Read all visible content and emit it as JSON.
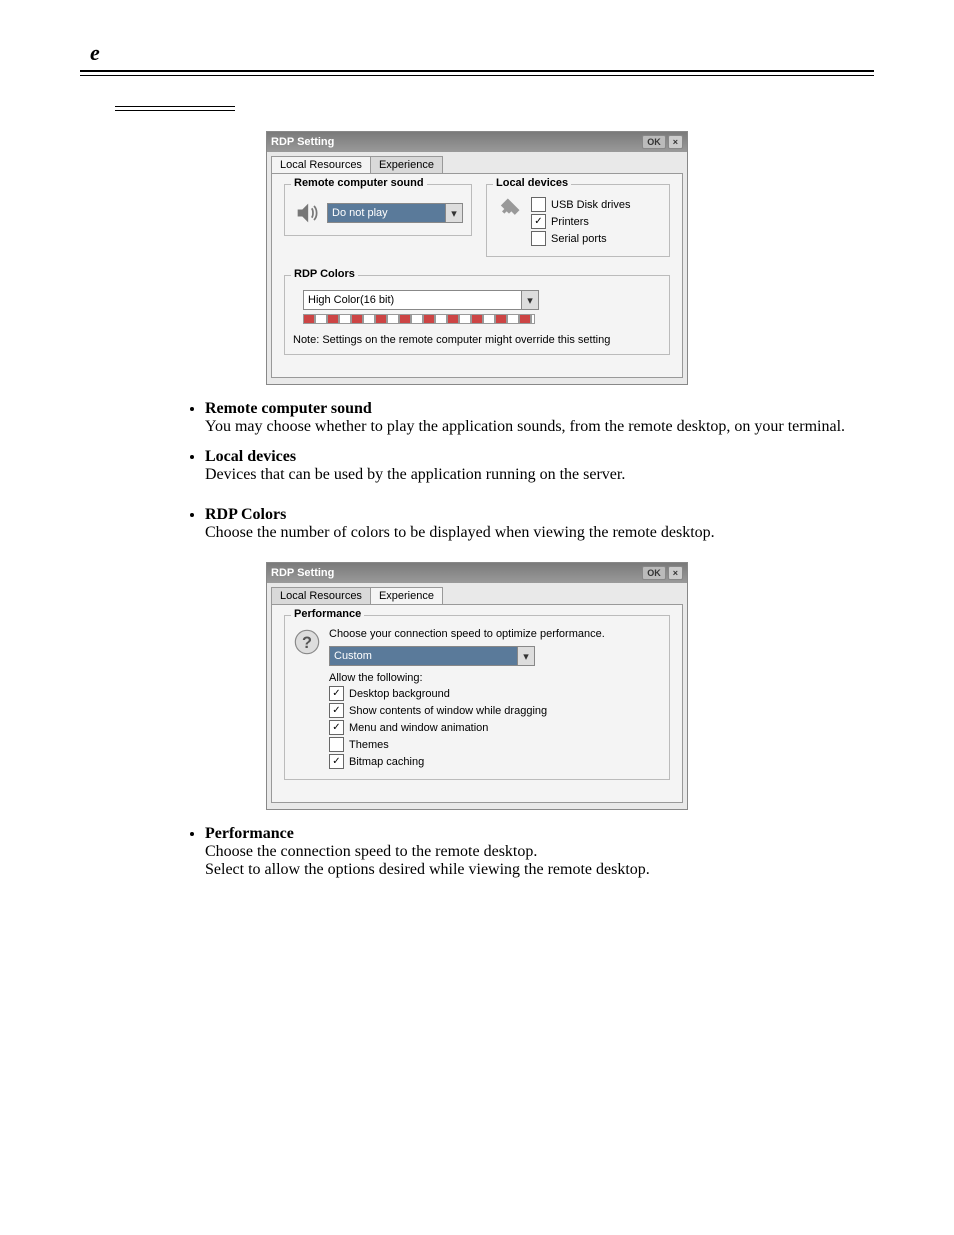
{
  "header_letter": "e",
  "window1": {
    "title": "RDP Setting",
    "ok": "OK",
    "tab_local": "Local Resources",
    "tab_exp": "Experience",
    "remote_sound_label": "Remote computer sound",
    "remote_sound_value": "Do not play",
    "local_devices_label": "Local devices",
    "usb_drives": "USB Disk drives",
    "printers": "Printers",
    "serial_ports": "Serial ports",
    "rdp_colors_label": "RDP Colors",
    "color_value": "High Color(16 bit)",
    "color_note": "Note: Settings on the remote computer might  override this setting"
  },
  "bullets1": {
    "remote_sound_title": "Remote computer sound",
    "remote_sound_desc": "You may choose whether to play the application sounds, from the remote desktop, on your terminal.",
    "local_devices_title": "Local devices",
    "local_devices_desc": "Devices that can be used by the application running on the server.",
    "rdp_colors_title": "RDP Colors",
    "rdp_colors_desc": "Choose the number of colors to be displayed when viewing the remote desktop."
  },
  "window2": {
    "title": "RDP Setting",
    "ok": "OK",
    "tab_local": "Local Resources",
    "tab_exp": "Experience",
    "perf_label": "Performance",
    "perf_prompt": "Choose your connection speed to optimize performance.",
    "conn_value": "Custom",
    "allow_label": "Allow the following:",
    "opt_bg": "Desktop background",
    "opt_drag": "Show contents of window while dragging",
    "opt_anim": "Menu and window animation",
    "opt_themes": "Themes",
    "opt_bitmap": "Bitmap caching"
  },
  "bullets2": {
    "perf_title": "Performance",
    "perf_desc1": "Choose the connection speed to the remote desktop.",
    "perf_desc2": "Select to allow the options desired while viewing the remote desktop."
  }
}
